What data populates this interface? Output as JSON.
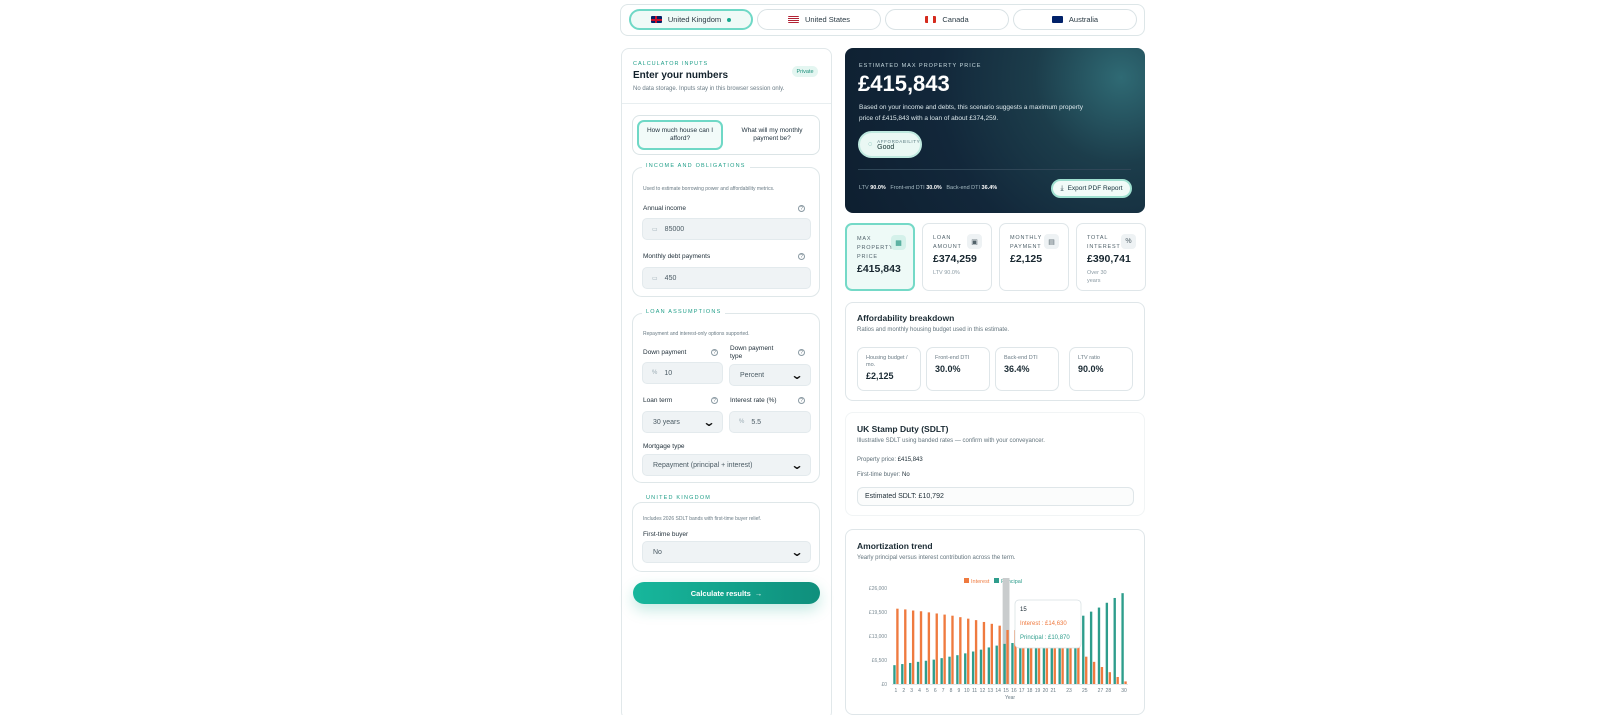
{
  "countries": [
    {
      "label": "United Kingdom",
      "active": true
    },
    {
      "label": "United States",
      "active": false
    },
    {
      "label": "Canada",
      "active": false
    },
    {
      "label": "Australia",
      "active": false
    }
  ],
  "inputs": {
    "eyebrow": "CALCULATOR INPUTS",
    "title": "Enter your numbers",
    "badge": "Private",
    "subtitle": "No data storage. Inputs stay in this browser session only.",
    "modes": [
      "How much house can I afford?",
      "What will my monthly payment be?"
    ],
    "income_section": {
      "title": "INCOME AND OBLIGATIONS",
      "desc": "Used to estimate borrowing power and affordability metrics.",
      "annual_income_label": "Annual income",
      "annual_income_value": "85000",
      "monthly_debt_label": "Monthly debt payments",
      "monthly_debt_value": "450"
    },
    "loan_section": {
      "title": "LOAN ASSUMPTIONS",
      "desc": "Repayment and interest-only options supported.",
      "down_payment_label": "Down payment",
      "down_payment_value": "10",
      "down_payment_type_label": "Down payment type",
      "down_payment_type_value": "Percent",
      "loan_term_label": "Loan term",
      "loan_term_value": "30 years",
      "interest_rate_label": "Interest rate (%)",
      "interest_rate_value": "5.5",
      "mortgage_type_label": "Mortgage type",
      "mortgage_type_value": "Repayment (principal + interest)"
    },
    "uk_section": {
      "title": "UNITED KINGDOM",
      "desc": "Includes 2026 SDLT bands with first-time buyer relief.",
      "ftb_label": "First-time buyer",
      "ftb_value": "No"
    },
    "calculate_label": "Calculate results",
    "calculate_arrow": "→"
  },
  "hero": {
    "eyebrow": "ESTIMATED MAX PROPERTY PRICE",
    "price": "£415,843",
    "text_line1": "Based on your income and debts, this scenario suggests a maximum property",
    "text_line2": "price of £415,843 with a loan of about £374,259.",
    "affordability_label": "AFFORDABILITY",
    "affordability_value": "Good",
    "ltv_label": "LTV",
    "ltv_value": "90.0%",
    "front_label": "Front-end DTI",
    "front_value": "30.0%",
    "back_label": "Back-end DTI",
    "back_value": "36.4%",
    "export_label": "Export PDF Report"
  },
  "kpis": [
    {
      "label_lines": [
        "MAX",
        "PROPERTY",
        "PRICE"
      ],
      "value": "£415,843",
      "sub": "",
      "icon": "▦",
      "active": true
    },
    {
      "label_lines": [
        "LOAN",
        "AMOUNT"
      ],
      "value": "£374,259",
      "sub": "LTV 90.0%",
      "icon": "▣",
      "active": false
    },
    {
      "label_lines": [
        "MONTHLY",
        "PAYMENT"
      ],
      "value": "£2,125",
      "sub": "",
      "icon": "▤",
      "active": false
    },
    {
      "label_lines": [
        "TOTAL",
        "INTEREST"
      ],
      "value": "£390,741",
      "sub": "Over 30 years",
      "icon": "%",
      "active": false
    }
  ],
  "breakdown": {
    "title": "Affordability breakdown",
    "subtitle": "Ratios and monthly housing budget used in this estimate.",
    "items": [
      {
        "label": "Housing budget / mo.",
        "value": "£2,125"
      },
      {
        "label": "Front-end DTI",
        "value": "30.0%"
      },
      {
        "label": "Back-end DTI",
        "value": "36.4%"
      },
      {
        "label": "LTV ratio",
        "value": "90.0%"
      }
    ]
  },
  "sdlt": {
    "title": "UK Stamp Duty (SDLT)",
    "subtitle": "Illustrative SDLT using banded rates — confirm with your conveyancer.",
    "price_label": "Property price:",
    "price_value": "£415,843",
    "ftb_label": "First-time buyer:",
    "ftb_value": "No",
    "estimate": "Estimated SDLT: £10,792"
  },
  "amortization": {
    "title": "Amortization trend",
    "subtitle": "Yearly principal versus interest contribution across the term.",
    "tooltip": {
      "year": "15",
      "interest": "Interest : £14,630",
      "principal": "Principal : £10,870"
    }
  },
  "colors": {
    "interest": "#ef7a3f",
    "principal": "#2e9d8c",
    "accent": "#19a98f"
  },
  "chart_data": {
    "type": "bar",
    "xlabel": "Year",
    "ylabel": "",
    "ylim": [
      0,
      26000
    ],
    "yticks": [
      "£0",
      "£6,500",
      "£13,000",
      "£19,500",
      "£26,000"
    ],
    "xtick_labels": [
      "1",
      "2",
      "3",
      "4",
      "5",
      "6",
      "7",
      "8",
      "9",
      "10",
      "11",
      "12",
      "13",
      "14",
      "15",
      "16",
      "17",
      "18",
      "19",
      "20",
      "21",
      "23",
      "25",
      "27",
      "28",
      "30"
    ],
    "categories": [
      1,
      2,
      3,
      4,
      5,
      6,
      7,
      8,
      9,
      10,
      11,
      12,
      13,
      14,
      15,
      16,
      17,
      18,
      19,
      20,
      21,
      22,
      23,
      24,
      25,
      26,
      27,
      28,
      29,
      30
    ],
    "series": [
      {
        "name": "Interest",
        "values": [
          20400,
          20200,
          19900,
          19700,
          19400,
          19100,
          18800,
          18500,
          18100,
          17700,
          17300,
          16800,
          16300,
          15800,
          14630,
          14600,
          14300,
          13900,
          13400,
          12900,
          12300,
          11600,
          10900,
          10000,
          7400,
          6000,
          4600,
          3200,
          1900,
          700
        ]
      },
      {
        "name": "Principal",
        "values": [
          5100,
          5400,
          5700,
          6000,
          6300,
          6600,
          7000,
          7400,
          7800,
          8300,
          8800,
          9300,
          9900,
          10400,
          10870,
          11100,
          11700,
          12300,
          12900,
          13600,
          14300,
          15000,
          15800,
          16700,
          18500,
          19600,
          20700,
          22000,
          23300,
          24600
        ]
      }
    ]
  }
}
